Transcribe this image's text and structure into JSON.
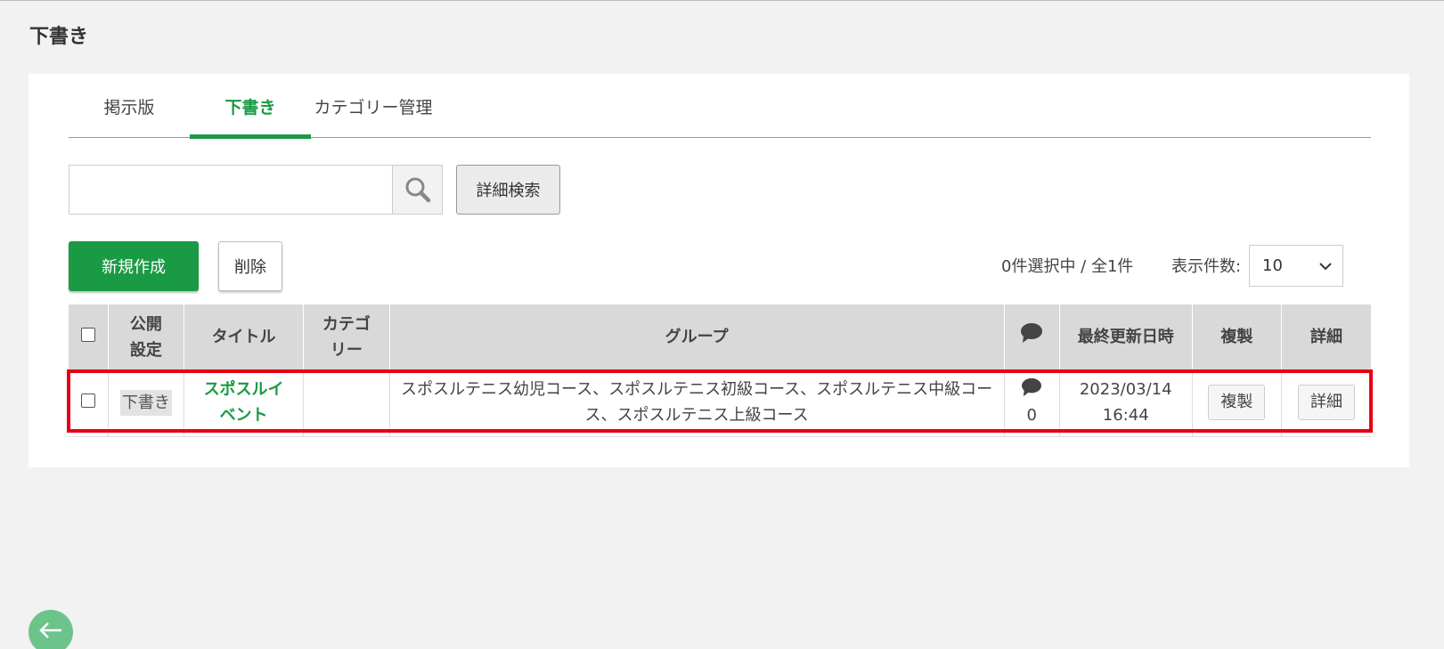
{
  "page": {
    "title": "下書き"
  },
  "tabs": [
    {
      "label": "掲示版",
      "active": false
    },
    {
      "label": "下書き",
      "active": true
    },
    {
      "label": "カテゴリー管理",
      "active": false
    }
  ],
  "search": {
    "value": "",
    "placeholder": "",
    "advanced_label": "詳細検索"
  },
  "actions": {
    "new_label": "新規作成",
    "delete_label": "削除"
  },
  "selection": {
    "count_text": "0件選択中 / 全1件",
    "per_page_label": "表示件数:",
    "per_page_value": "10"
  },
  "table": {
    "headers": {
      "visibility": "公開設定",
      "title": "タイトル",
      "category": "カテゴリー",
      "group": "グループ",
      "comments_icon": "comment-icon",
      "updated": "最終更新日時",
      "duplicate": "複製",
      "detail": "詳細"
    },
    "rows": [
      {
        "status": "下書き",
        "title": "スポスルイベント",
        "category": "",
        "group": "スポスルテニス幼児コース、スポスルテニス初級コース、スポスルテニス中級コース、スポスルテニス上級コース",
        "comments": "0",
        "updated_date": "2023/03/14",
        "updated_time": "16:44",
        "duplicate_label": "複製",
        "detail_label": "詳細"
      }
    ]
  },
  "colors": {
    "accent": "#1a9a44",
    "highlight": "#e60012",
    "back_button": "#6cc48b"
  }
}
